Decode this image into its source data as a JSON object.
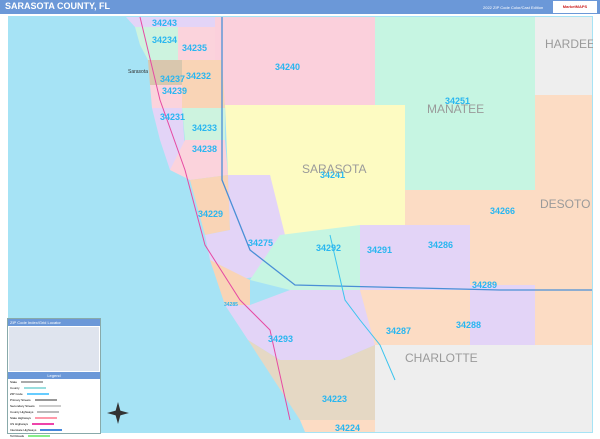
{
  "header": {
    "title": "SARASOTA COUNTY, FL",
    "subtitle": "2022 ZIP Code Color/Cast Edition",
    "logo": "MarketMAPS"
  },
  "counties": [
    "HARDEE",
    "MANATEE",
    "SARASOTA",
    "DESOTO",
    "CHARLOTTE"
  ],
  "cities": [
    "Sarasota"
  ],
  "zips": [
    "34243",
    "34234",
    "34235",
    "34240",
    "34237",
    "34232",
    "34239",
    "34231",
    "34233",
    "34238",
    "34251",
    "34241",
    "34266",
    "34229",
    "34275",
    "34292",
    "34291",
    "34286",
    "34289",
    "34287",
    "34288",
    "34293",
    "34285",
    "34223",
    "34224"
  ],
  "legend": {
    "title": "ZIP Code Index/Grid Locator",
    "subtitle": "Legend",
    "items": [
      "State",
      "County",
      "ZIP Code",
      "Primary Streets",
      "Secondary Streets",
      "County Highways",
      "State Highways",
      "US Highways",
      "Interstate Highways",
      "Toll Roads"
    ]
  },
  "colors": {
    "water": "#a6e3f5",
    "header": "#6b98d8",
    "zip_label": "#29b6f0"
  }
}
